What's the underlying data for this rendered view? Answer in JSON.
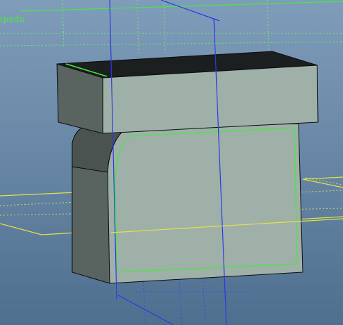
{
  "viewport": {
    "view_label": "epedu",
    "background_top": "#7f9dba",
    "background_bottom": "#4f6f90"
  },
  "colors": {
    "face_top": "#1b1f20",
    "face_front": "#9fb0a9",
    "face_side": "#59635f",
    "face_side_dark": "#4a5350",
    "edge": "#0c0c0c",
    "sketch_green": "#48e83e",
    "plane_blue": "#2b38e6",
    "plane_yellow": "#e4e242",
    "dotted_green": "#6fe86a",
    "dotted_blue": "#3a48e0",
    "dotted_yellow": "#d8d750"
  },
  "icons": {
    "model": "3d-solid-model-icon"
  }
}
